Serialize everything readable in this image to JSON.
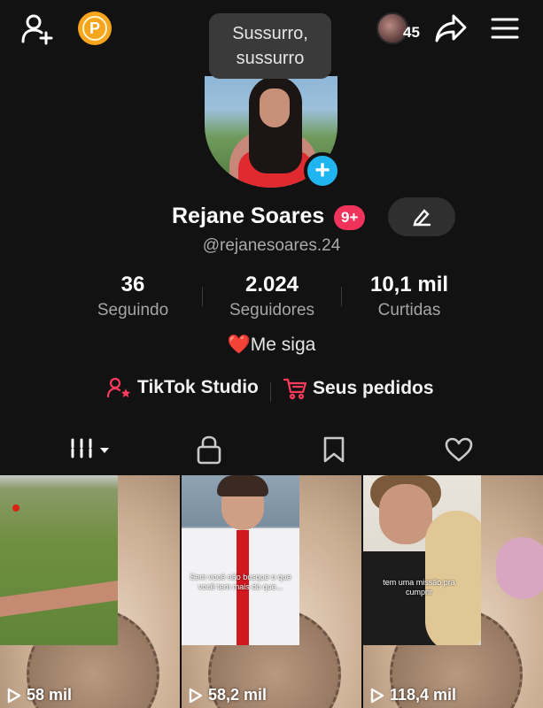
{
  "header": {
    "add_friend_icon": "person-plus-icon",
    "coin_icon": "coin-icon",
    "coin_letter": "P",
    "profile_views_count": "45",
    "share_icon": "share-arrow-icon",
    "menu_icon": "hamburger-menu-icon"
  },
  "tooltip": {
    "text": "Sussurro, sussurro"
  },
  "profile": {
    "display_name": "Rejane Soares",
    "notification_badge": "9+",
    "username": "@rejanesoares.24",
    "avatar_add_icon": "plus-icon",
    "edit_icon": "pencil-icon"
  },
  "stats": [
    {
      "value": "36",
      "label": "Seguindo"
    },
    {
      "value": "2.024",
      "label": "Seguidores"
    },
    {
      "value": "10,1 mil",
      "label": "Curtidas"
    }
  ],
  "bio": "❤️Me siga",
  "links": {
    "studio_label": "TikTok Studio",
    "orders_label": "Seus pedidos",
    "studio_icon": "person-star-icon",
    "orders_icon": "shopping-cart-icon"
  },
  "tabs": [
    {
      "name": "videos",
      "icon": "grid-filter-icon",
      "active": true
    },
    {
      "name": "private",
      "icon": "lock-icon",
      "active": false
    },
    {
      "name": "favorites",
      "icon": "bookmark-icon",
      "active": false
    },
    {
      "name": "liked",
      "icon": "heart-icon",
      "active": false
    }
  ],
  "videos": [
    {
      "views": "58 mil"
    },
    {
      "views": "58,2 mil",
      "caption": "Sem você não busque o que você tem mais do que..."
    },
    {
      "views": "118,4 mil",
      "caption": "tem uma missão pra cumprir"
    }
  ],
  "colors": {
    "background": "#121212",
    "accent_red": "#f0335a",
    "plus_blue": "#20b5f0",
    "coin_orange": "#f7a51d"
  }
}
